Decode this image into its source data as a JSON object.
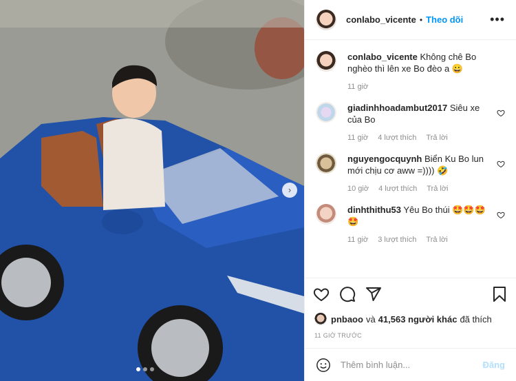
{
  "post": {
    "author": "conlabo_vicente",
    "separator": "•",
    "follow_label": "Theo dõi",
    "more_label": "•••"
  },
  "comments": [
    {
      "user": "conlabo_vicente",
      "text": "Không chê Bo nghèo thì lên xe Bo đèo a 😀",
      "time": "11 giờ",
      "likes": "",
      "reply": ""
    },
    {
      "user": "giadinhhoadambut2017",
      "text": "Siêu xe của Bo",
      "time": "11 giờ",
      "likes": "4 lượt thích",
      "reply": "Trả lời"
    },
    {
      "user": "nguyengocquynh",
      "text": "Biển Ku Bo lun mới chịu cơ aww =)))) 🤣",
      "time": "10 giờ",
      "likes": "4 lượt thích",
      "reply": "Trả lời"
    },
    {
      "user": "dinhthithu53",
      "text": "Yêu Bo thúi 🤩🤩🤩 🤩",
      "time": "11 giờ",
      "likes": "3 lượt thích",
      "reply": "Trả lời"
    }
  ],
  "likes": {
    "user": "pnbaoo",
    "connector": "và",
    "count": "41,563 người khác",
    "suffix": "đã thích"
  },
  "time_ago": "11 GIỜ TRƯỚC",
  "add_comment": {
    "placeholder": "Thêm bình luận...",
    "post_label": "Đăng"
  },
  "carousel": {
    "total": 3,
    "active": 1
  },
  "colors": {
    "link": "#0095f6",
    "muted": "#8e8e8e",
    "post_disabled": "#b2dffc",
    "car_blue": "#1f4fa3"
  },
  "icons": [
    "heart-icon",
    "comment-icon",
    "share-icon",
    "bookmark-icon",
    "emoji-icon",
    "chevron-right-icon"
  ]
}
